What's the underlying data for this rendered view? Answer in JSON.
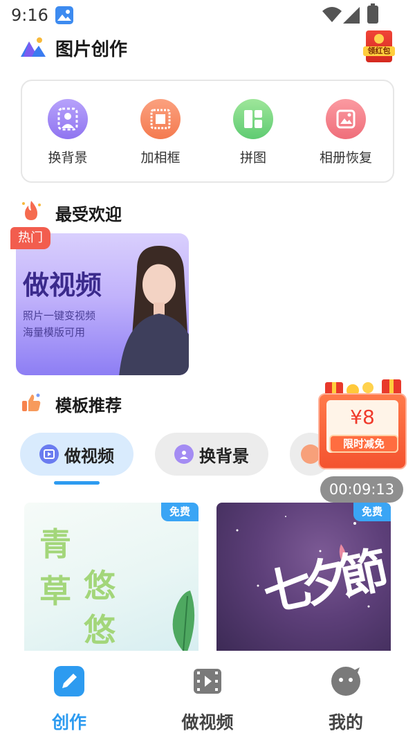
{
  "status_bar": {
    "time": "9:16"
  },
  "header": {
    "title": "图片创作",
    "red_packet_label": "领红包"
  },
  "tools": [
    {
      "label": "换背景",
      "icon": "person-silhouette-icon",
      "color": "#9b7ff2"
    },
    {
      "label": "加相框",
      "icon": "frame-icon",
      "color": "#f7855d"
    },
    {
      "label": "拼图",
      "icon": "collage-icon",
      "color": "#6dd07a"
    },
    {
      "label": "相册恢复",
      "icon": "photo-restore-icon",
      "color": "#f0727e"
    }
  ],
  "popular": {
    "section_title": "最受欢迎",
    "badge": "热门",
    "card": {
      "title": "做视频",
      "line1": "照片一键变视频",
      "line2": "海量模版可用"
    }
  },
  "templates": {
    "section_title": "模板推荐",
    "tabs": [
      {
        "label": "做视频",
        "active": true
      },
      {
        "label": "换背景",
        "active": false
      }
    ],
    "cards": [
      {
        "badge": "免费",
        "chars": [
          "青",
          "草",
          "悠",
          "悠"
        ]
      },
      {
        "badge": "免费",
        "art_text": "七夕節"
      }
    ]
  },
  "floating_promo": {
    "price": "¥8",
    "label": "限时减免",
    "countdown": "00:09:13"
  },
  "bottom_nav": [
    {
      "label": "创作",
      "icon": "pencil-icon",
      "active": true
    },
    {
      "label": "做视频",
      "icon": "video-icon",
      "active": false
    },
    {
      "label": "我的",
      "icon": "chat-face-icon",
      "active": false
    }
  ],
  "colors": {
    "accent": "#2d9bf0",
    "hot": "#f25d4e",
    "promo": "#f4532f"
  }
}
